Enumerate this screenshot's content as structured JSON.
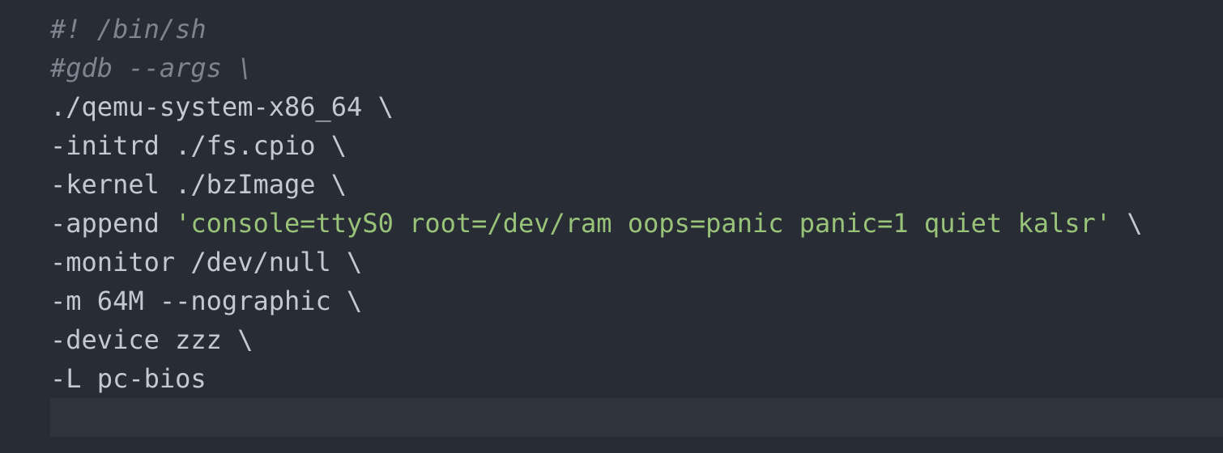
{
  "editor": {
    "lines": [
      {
        "segments": [
          {
            "text": "#! /bin/sh",
            "cls": "comment"
          }
        ]
      },
      {
        "segments": [
          {
            "text": "#gdb --args \\",
            "cls": "comment"
          }
        ]
      },
      {
        "segments": [
          {
            "text": "./qemu-system-x86_64 \\",
            "cls": "plain"
          }
        ]
      },
      {
        "segments": [
          {
            "text": "-initrd ./fs.cpio \\",
            "cls": "plain"
          }
        ]
      },
      {
        "segments": [
          {
            "text": "-kernel ./bzImage \\",
            "cls": "plain"
          }
        ]
      },
      {
        "segments": [
          {
            "text": "-append ",
            "cls": "plain"
          },
          {
            "text": "'console=ttyS0 root=/dev/ram oops=panic panic=1 quiet kalsr'",
            "cls": "string"
          },
          {
            "text": " \\",
            "cls": "plain"
          }
        ]
      },
      {
        "segments": [
          {
            "text": "-monitor /dev/null \\",
            "cls": "plain"
          }
        ]
      },
      {
        "segments": [
          {
            "text": "-m 64M --nographic \\",
            "cls": "plain"
          }
        ]
      },
      {
        "segments": [
          {
            "text": "-device zzz \\",
            "cls": "plain"
          }
        ]
      },
      {
        "segments": [
          {
            "text": "-L pc-bios",
            "cls": "plain"
          }
        ]
      }
    ]
  },
  "colors": {
    "background": "#282c34",
    "current_line": "#2f333d",
    "text": "#c4c9d1",
    "comment": "#7d8591",
    "string": "#98c379"
  }
}
